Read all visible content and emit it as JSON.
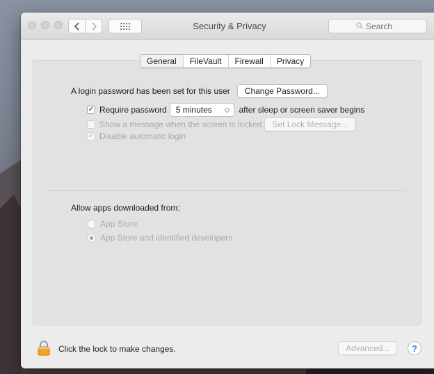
{
  "window": {
    "title": "Security & Privacy",
    "search_placeholder": "Search",
    "grid_glyph": "⁞⁞⁞⁞"
  },
  "tabs": [
    {
      "label": "General",
      "selected": true
    },
    {
      "label": "FileVault",
      "selected": false
    },
    {
      "label": "Firewall",
      "selected": false
    },
    {
      "label": "Privacy",
      "selected": false
    }
  ],
  "general": {
    "login_text": "A login password has been set for this user",
    "change_password_label": "Change Password...",
    "require_password": {
      "label": "Require password",
      "checked": true,
      "interval": "5 minutes",
      "suffix": "after sleep or screen saver begins"
    },
    "show_message": {
      "label": "Show a message when the screen is locked",
      "checked": false,
      "button": "Set Lock Message..."
    },
    "disable_login": {
      "label": "Disable automatic login",
      "checked": true
    }
  },
  "downloads": {
    "heading": "Allow apps downloaded from:",
    "options": [
      {
        "label": "App Store",
        "selected": false
      },
      {
        "label": "App Store and identified developers",
        "selected": true
      }
    ]
  },
  "footer": {
    "lock_text": "Click the lock to make changes.",
    "advanced_label": "Advanced...",
    "help_label": "?"
  },
  "colors": {
    "lock_body": "#f0a32a",
    "help_accent": "#3b7de0"
  }
}
